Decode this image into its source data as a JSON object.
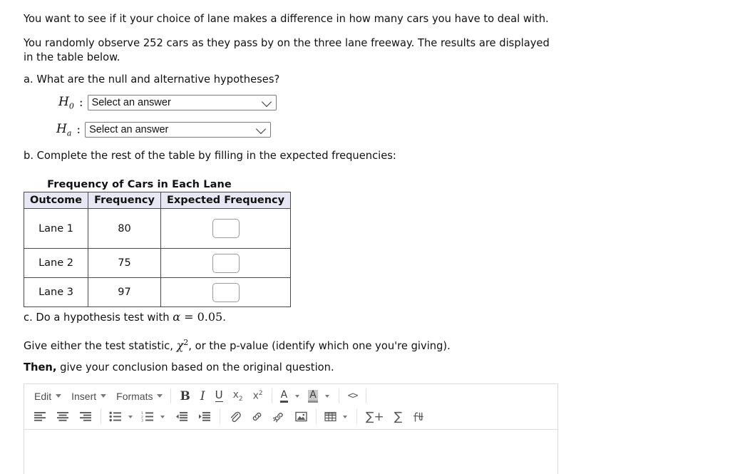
{
  "question": {
    "intro_1": "You want to see if it your choice of lane makes a difference in how many cars you have to deal with.",
    "intro_2": "You randomly observe 252 cars as they pass by on the three lane freeway. The results are displayed in the table below.",
    "part_a": "a. What are the null and alternative hypotheses?",
    "part_b": "b. Complete the rest of the table by filling in the expected frequencies:",
    "part_c_prefix": "c. Do a hypothesis test with ",
    "part_c_alpha": "α",
    "part_c_eq": " = ",
    "part_c_value": "0.05",
    "part_c_suffix": ".",
    "give_prefix": "Give either the test statistic, ",
    "give_chi": "χ",
    "give_chi_exp": "2",
    "give_suffix": ",  or the p-value (identify which one you're giving).",
    "then_bold": "Then,",
    "then_rest": " give your conclusion based on the original question."
  },
  "hypotheses": {
    "null": {
      "symbol": "H",
      "subscript": "0",
      "colon": ":",
      "selected": "Select an answer",
      "placeholder": "Select an answer"
    },
    "alternative": {
      "symbol": "H",
      "subscript": "a",
      "colon": ":",
      "selected": "Select an answer",
      "placeholder": "Select an answer"
    }
  },
  "freq_table": {
    "caption": "Frequency of Cars in Each Lane",
    "headers": [
      "Outcome",
      "Frequency",
      "Expected Frequency"
    ],
    "rows": [
      {
        "outcome": "Lane 1",
        "frequency": "80",
        "expected": ""
      },
      {
        "outcome": "Lane 2",
        "frequency": "75",
        "expected": ""
      },
      {
        "outcome": "Lane 3",
        "frequency": "97",
        "expected": ""
      }
    ]
  },
  "editor": {
    "menus": [
      {
        "label": "Edit",
        "name": "edit-menu"
      },
      {
        "label": "Insert",
        "name": "insert-menu"
      },
      {
        "label": "Formats",
        "name": "formats-menu"
      }
    ],
    "row1_buttons": [
      {
        "name": "bold-icon",
        "glyph": "B"
      },
      {
        "name": "italic-icon",
        "glyph": "I"
      },
      {
        "name": "underline-icon",
        "glyph": "U"
      },
      {
        "name": "subscript-icon",
        "glyph": "x"
      },
      {
        "name": "superscript-icon",
        "glyph": "x"
      },
      {
        "name": "text-color-icon",
        "glyph": "A"
      },
      {
        "name": "highlight-color-icon",
        "glyph": "A"
      },
      {
        "name": "source-code-icon",
        "glyph": "<>"
      }
    ],
    "row2_buttons": [
      {
        "name": "align-left-icon"
      },
      {
        "name": "align-center-icon"
      },
      {
        "name": "align-right-icon"
      },
      {
        "name": "bullet-list-icon"
      },
      {
        "name": "numbered-list-icon"
      },
      {
        "name": "outdent-icon"
      },
      {
        "name": "indent-icon"
      },
      {
        "name": "attachment-icon"
      },
      {
        "name": "link-icon"
      },
      {
        "name": "unlink-icon"
      },
      {
        "name": "image-icon"
      },
      {
        "name": "table-icon"
      },
      {
        "name": "insert-equation-icon",
        "glyph": "∑+"
      },
      {
        "name": "sum-icon",
        "glyph": "∑"
      },
      {
        "name": "math-function-icon",
        "glyph": "ƙ"
      }
    ],
    "body_text": ""
  },
  "colors": {
    "table_header_bg": "#e8e8f4",
    "table_border": "#4a4a4a",
    "editor_border": "#dcdcdc",
    "icon_gray": "#5a5a5a",
    "select_border": "#7a7a7a"
  }
}
